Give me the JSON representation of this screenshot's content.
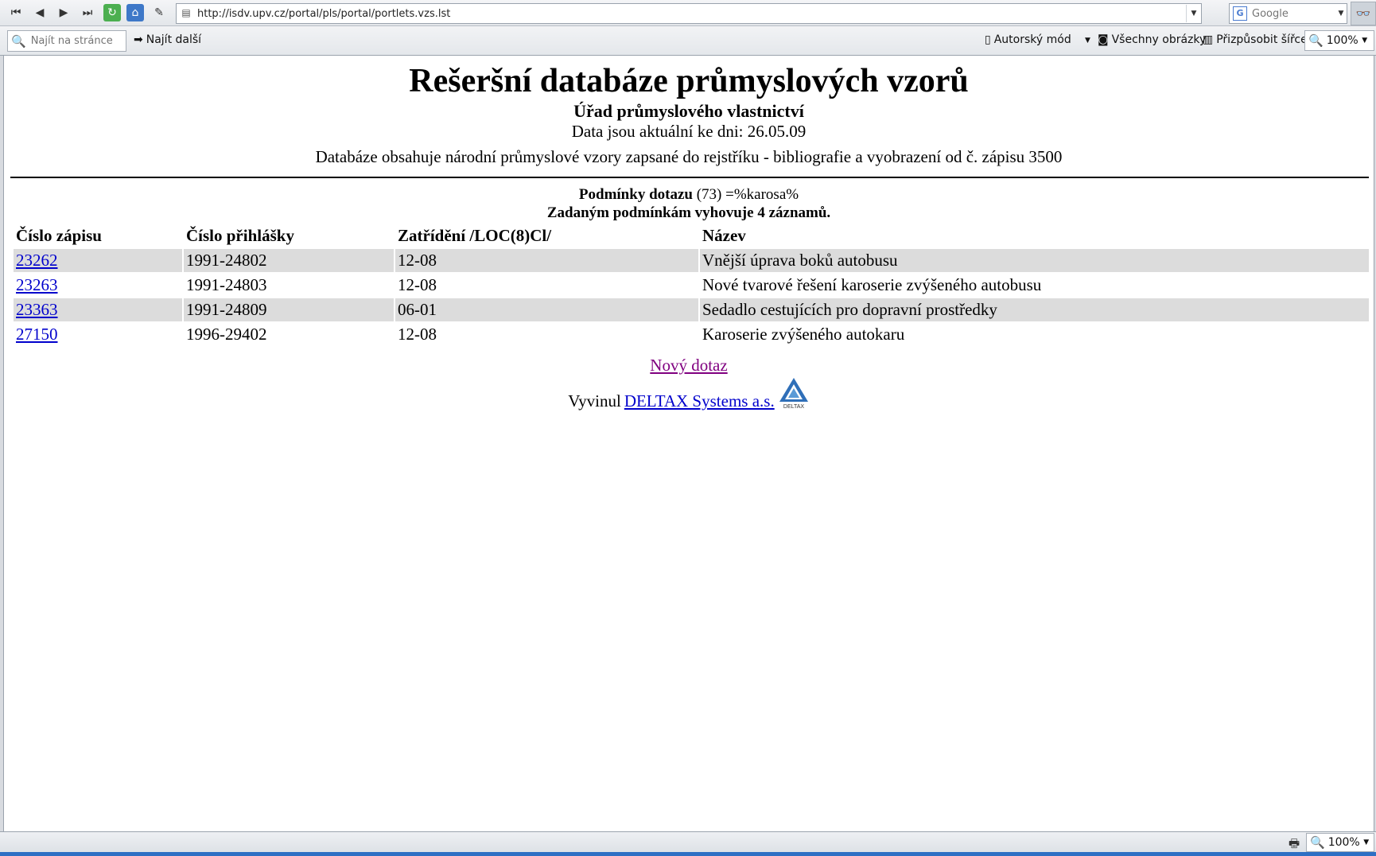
{
  "browser": {
    "url": "http://isdv.upv.cz/portal/pls/portal/portlets.vzs.lst",
    "search_placeholder": "Google",
    "find_placeholder": "Najít na stránce",
    "find_next_label": "Najít další",
    "author_mode_label": "Autorský mód",
    "all_images_label": "Všechny obrázky",
    "fit_width_label": "Přizpůsobit šířce",
    "zoom_level": "100%",
    "status_zoom_level": "100%"
  },
  "page": {
    "title": "Rešeršní databáze průmyslových vzorů",
    "subtitle": "Úřad průmyslového vlastnictví",
    "date_line": "Data jsou aktuální ke dni: 26.05.09",
    "description": "Databáze obsahuje národní průmyslové vzory zapsané do rejstříku - bibliografie a vyobrazení od č. zápisu 3500",
    "query_label": "Podmínky dotazu",
    "query_value": " (73) =%karosa%",
    "result_count": "Zadaným podmínkám vyhovuje 4 záznamů.",
    "table": {
      "headers": [
        "Číslo zápisu",
        "Číslo přihlášky",
        "Zatřídění /LOC(8)Cl/",
        "Název"
      ],
      "rows": [
        {
          "reg_no": "23262",
          "app_no": "1991-24802",
          "loc": "12-08",
          "name": "Vnější úprava boků autobusu"
        },
        {
          "reg_no": "23263",
          "app_no": "1991-24803",
          "loc": "12-08",
          "name": "Nové tvarové řešení karoserie zvýšeného autobusu"
        },
        {
          "reg_no": "23363",
          "app_no": "1991-24809",
          "loc": "06-01",
          "name": "Sedadlo cestujících pro dopravní prostředky"
        },
        {
          "reg_no": "27150",
          "app_no": "1996-29402",
          "loc": "12-08",
          "name": "Karoserie zvýšeného autokaru"
        }
      ]
    },
    "new_query_link": "Nový dotaz",
    "developed_by": "Vyvinul",
    "developer_link": "DELTAX Systems a.s.",
    "logo_text": "DELTAX"
  },
  "colors": {
    "link": "#0000cc",
    "visited_link": "#800080",
    "row_shade": "#dcdcdc"
  }
}
